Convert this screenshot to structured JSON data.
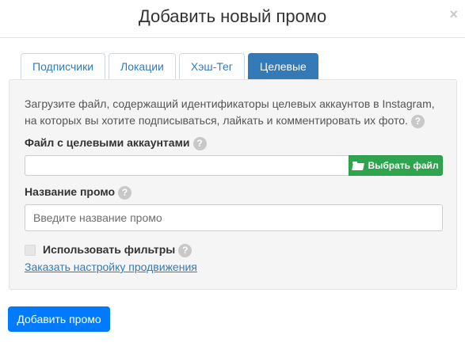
{
  "modal": {
    "title": "Добавить новый промо",
    "close_symbol": "×"
  },
  "tabs": [
    {
      "label": "Подписчики",
      "active": false
    },
    {
      "label": "Локации",
      "active": false
    },
    {
      "label": "Хэш-Тег",
      "active": false
    },
    {
      "label": "Целевые",
      "active": true
    }
  ],
  "form": {
    "description": "Загрузите файл, содержащий идентификаторы целевых аккаунтов в Instagram, на которых вы хотите подписываться, лайкать и комментировать их фото.",
    "help_symbol": "?",
    "file_label": "Файл с целевыми аккаунтами",
    "file_value": "",
    "file_button": "Выбрать файл",
    "name_label": "Название промо",
    "name_value": "",
    "name_placeholder": "Введите название промо",
    "filters_label": "Использовать фильтры",
    "filters_checked": false,
    "order_link": "Заказать настройку продвижения"
  },
  "footer": {
    "submit_label": "Добавить промо"
  },
  "icons": {
    "close": "close-icon",
    "help": "question-icon",
    "folder": "folder-open-icon"
  },
  "colors": {
    "tab_active": "#337ab7",
    "file_button": "#2ea44f",
    "submit_button": "#007bff",
    "link": "#337ab7"
  }
}
